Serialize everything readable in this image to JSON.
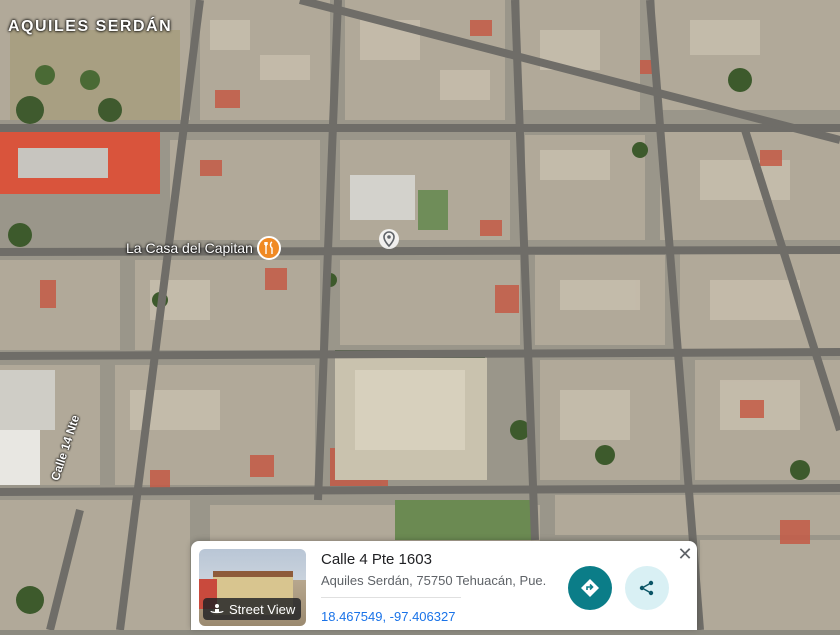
{
  "map": {
    "district_label": "AQUILES SERDÁN",
    "poi": {
      "name": "La Casa del Capitan",
      "icon": "restaurant-icon",
      "color": "#f08a24"
    },
    "dropped_pin_icon": "location-pin-icon",
    "street_label": "Calle 14 Nte"
  },
  "card": {
    "title": "Calle 4 Pte 1603",
    "address": "Aquiles Serdán, 75750 Tehuacán, Pue.",
    "coordinates": "18.467549, -97.406327",
    "street_view_label": "Street View",
    "directions_icon": "directions-icon",
    "share_icon": "share-icon",
    "close_icon": "close-icon",
    "accent_color": "#0b7d88"
  }
}
